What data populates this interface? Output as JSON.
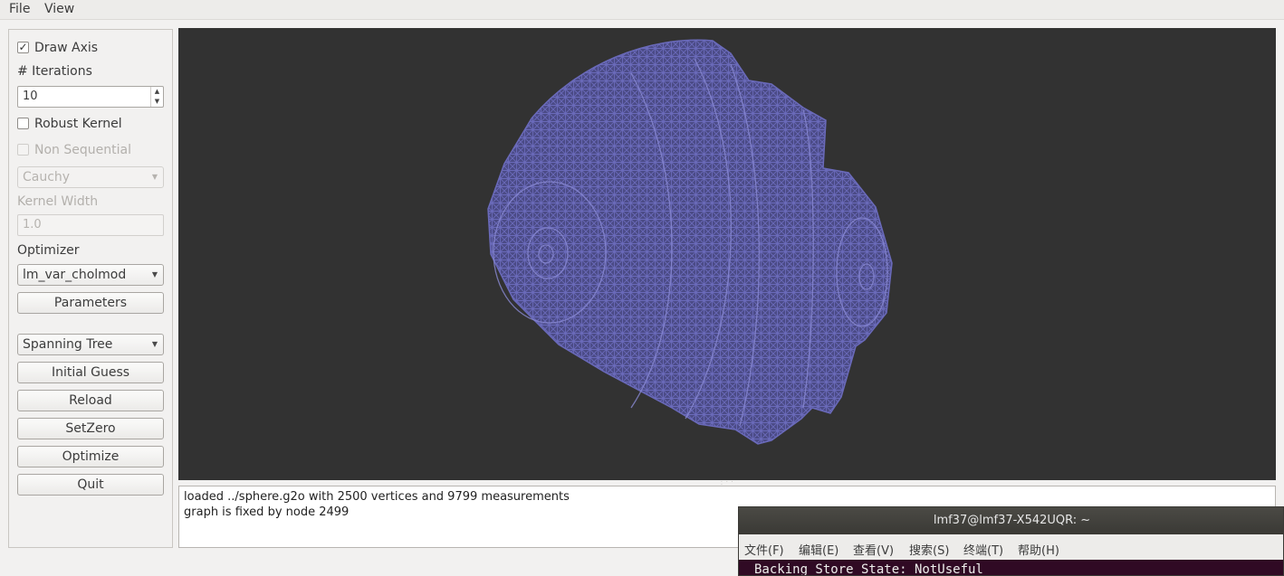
{
  "menubar": {
    "file": "File",
    "view": "View"
  },
  "left_panel": {
    "draw_axis": {
      "label": "Draw Axis",
      "checked": true,
      "mark": "✓"
    },
    "iterations": {
      "label": "# Iterations",
      "value": "10"
    },
    "robust_kernel": {
      "label": "Robust Kernel",
      "checked": false
    },
    "non_sequential": {
      "label": "Non Sequential",
      "checked": false
    },
    "kernel_type": {
      "value": "Cauchy"
    },
    "kernel_width": {
      "label": "Kernel Width",
      "value": "1.0"
    },
    "optimizer": {
      "label": "Optimizer",
      "value": "lm_var_cholmod"
    },
    "buttons": {
      "parameters": "Parameters",
      "initial_guess": "Initial Guess",
      "reload": "Reload",
      "setzero": "SetZero",
      "optimize": "Optimize",
      "quit": "Quit"
    },
    "initial_guess_method": {
      "value": "Spanning Tree"
    }
  },
  "viewport": {
    "background_color": "#323232",
    "mesh_color": "#6a6aba"
  },
  "log": {
    "lines": [
      "loaded ../sphere.g2o with 2500 vertices and 9799 measurements",
      "graph is fixed by node 2499"
    ]
  },
  "terminal": {
    "title": "lmf37@lmf37-X542UQR: ~",
    "menu": [
      "文件(F)",
      "编辑(E)",
      "查看(V)",
      "搜索(S)",
      "终端(T)",
      "帮助(H)"
    ],
    "text": "Backing Store State: NotUseful"
  }
}
